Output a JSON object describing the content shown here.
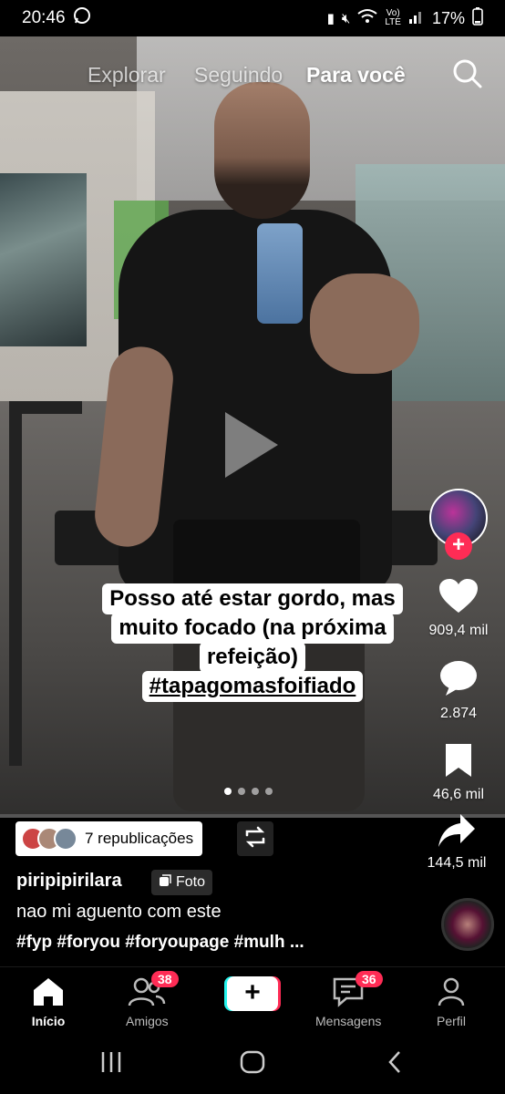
{
  "status_bar": {
    "time": "20:46",
    "battery": "17%",
    "icons": [
      "whatsapp-icon",
      "battery-saver-icon",
      "mute-icon",
      "wifi-icon",
      "volte-icon",
      "signal-icon"
    ]
  },
  "top_nav": {
    "tabs": [
      {
        "label": "Explorar",
        "active": false
      },
      {
        "label": "Seguindo",
        "active": false
      },
      {
        "label": "Para você",
        "active": true
      }
    ],
    "search_icon": "search-icon"
  },
  "post": {
    "caption_lines": [
      "Posso até estar gordo, mas",
      "muito focado (na próxima",
      "refeição)"
    ],
    "caption_hashtag": "#tapagomasfoifiado",
    "carousel": {
      "total": 4,
      "current": 1
    }
  },
  "actions": {
    "likes": "909,4 mil",
    "comments": "2.874",
    "saves": "46,6 mil",
    "shares": "144,5 mil"
  },
  "info": {
    "republications": "7 republicações",
    "username": "piripipirilara",
    "badge": "Foto",
    "description": "nao mi aguento com este",
    "hashtags": "#fyp #foryou #foryoupage #mulh ..."
  },
  "tabbar": {
    "home": "Início",
    "friends": "Amigos",
    "friends_badge": "38",
    "messages": "Mensagens",
    "messages_badge": "36",
    "profile": "Perfil",
    "create": "+"
  },
  "colors": {
    "accent_red": "#fe2c55",
    "accent_cyan": "#25f4ee",
    "background": "#000000"
  }
}
